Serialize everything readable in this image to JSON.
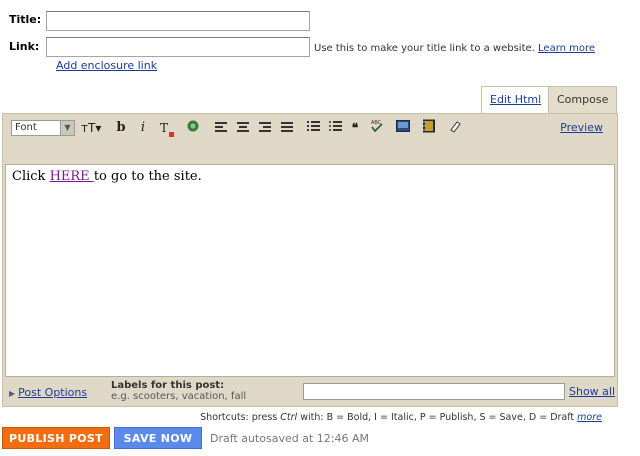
{
  "form": {
    "title_label": "Title:",
    "link_label": "Link:",
    "link_hint": "Use this to make your title link to a website.",
    "learn_more": "Learn more",
    "add_enclosure": "Add enclosure link"
  },
  "tabs": [
    {
      "label": "Edit Html",
      "active": false
    },
    {
      "label": "Compose",
      "active": true
    }
  ],
  "toolbar": {
    "font_value": "Font",
    "font_size_glyph": "тT▾",
    "bold": "b",
    "italic": "i",
    "text_color": "T",
    "preview": "Preview"
  },
  "editor": {
    "text_before": "Click ",
    "link_text": "HERE ",
    "text_after": "to go to the site."
  },
  "post_options": {
    "label": "Post Options",
    "labels_title": "Labels for this post:",
    "labels_example": "e.g. scooters, vacation, fall",
    "show_all": "Show all"
  },
  "shortcuts": {
    "prefix": "Shortcuts: press",
    "key": "Ctrl",
    "with": "with:",
    "items": "B = Bold, I = Italic, P = Publish, S = Save, D = Draft",
    "more": "more"
  },
  "actions": {
    "publish": "PUBLISH POST",
    "save": "SAVE NOW",
    "status": "Draft autosaved at 12:46 AM"
  },
  "colors": {
    "publish_bg": "#f26d0f",
    "save_bg": "#5a8bea",
    "toolbar_bg": "#e0d8c6",
    "link": "#1c3c9c"
  }
}
